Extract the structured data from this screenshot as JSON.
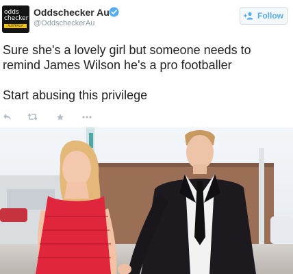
{
  "user": {
    "display_name": "Oddschecker Au",
    "handle": "@OddscheckerAu",
    "avatar_line1": "odds",
    "avatar_line2": "checker",
    "avatar_strip": "AUSTRALIA"
  },
  "follow_button": {
    "label": "Follow"
  },
  "tweet": {
    "line1": "Sure she's a lovely girl but someone needs to",
    "line2": "remind James Wilson he's a pro footballer",
    "line3": "Start abusing this privilege"
  },
  "icons": {
    "verified": "verified-badge-icon",
    "follow": "add-user-icon",
    "reply": "reply-icon",
    "retweet": "retweet-icon",
    "favorite": "star-icon",
    "more": "more-icon"
  },
  "colors": {
    "accent": "#55acee",
    "text": "#222222",
    "muted": "#8899a6"
  }
}
